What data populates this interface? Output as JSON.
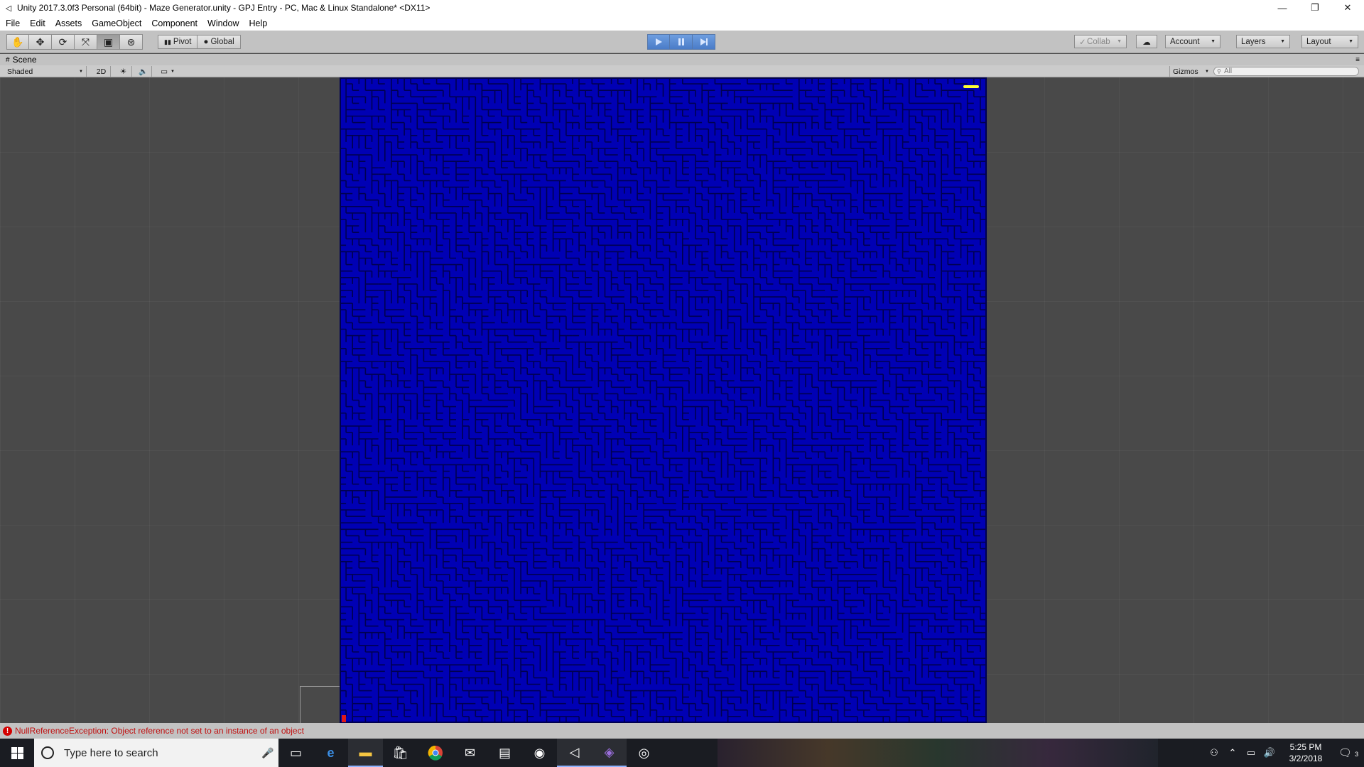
{
  "window": {
    "title": "Unity 2017.3.0f3 Personal (64bit) - Maze Generator.unity - GPJ Entry - PC, Mac & Linux Standalone* <DX11>",
    "controls": [
      "minimize",
      "restore",
      "close"
    ]
  },
  "menu": [
    "File",
    "Edit",
    "Assets",
    "GameObject",
    "Component",
    "Window",
    "Help"
  ],
  "toolbar": {
    "transform_tools": [
      "hand-icon",
      "move-icon",
      "rotate-icon",
      "scale-icon",
      "rect-tool-icon",
      "transform-all-icon"
    ],
    "pivot_label": "Pivot",
    "global_label": "Global",
    "play_state": "playing",
    "collab_label": "Collab",
    "account_label": "Account",
    "layers_label": "Layers",
    "layout_label": "Layout"
  },
  "scene": {
    "tab_label": "Scene",
    "shading_mode": "Shaded",
    "mode_2d_label": "2D",
    "gizmos_label": "Gizmos",
    "search_placeholder": "All"
  },
  "maze": {
    "background_color": "#0000b4",
    "wall_color": "#000050",
    "goal_color": "#ffff33",
    "player_color": "#e01818"
  },
  "status": {
    "error_message": "NullReferenceException: Object reference not set to an instance of an object"
  },
  "taskbar": {
    "search_placeholder": "Type here to search",
    "pinned_apps": [
      "task-view-icon",
      "edge-icon",
      "file-explorer-icon",
      "store-icon",
      "chrome-icon",
      "mail-icon",
      "photos-icon",
      "media-icon",
      "unity-icon",
      "visual-studio-icon",
      "unity-hub-icon"
    ],
    "time": "5:25 PM",
    "date": "3/2/2018",
    "notification_count": "3"
  }
}
